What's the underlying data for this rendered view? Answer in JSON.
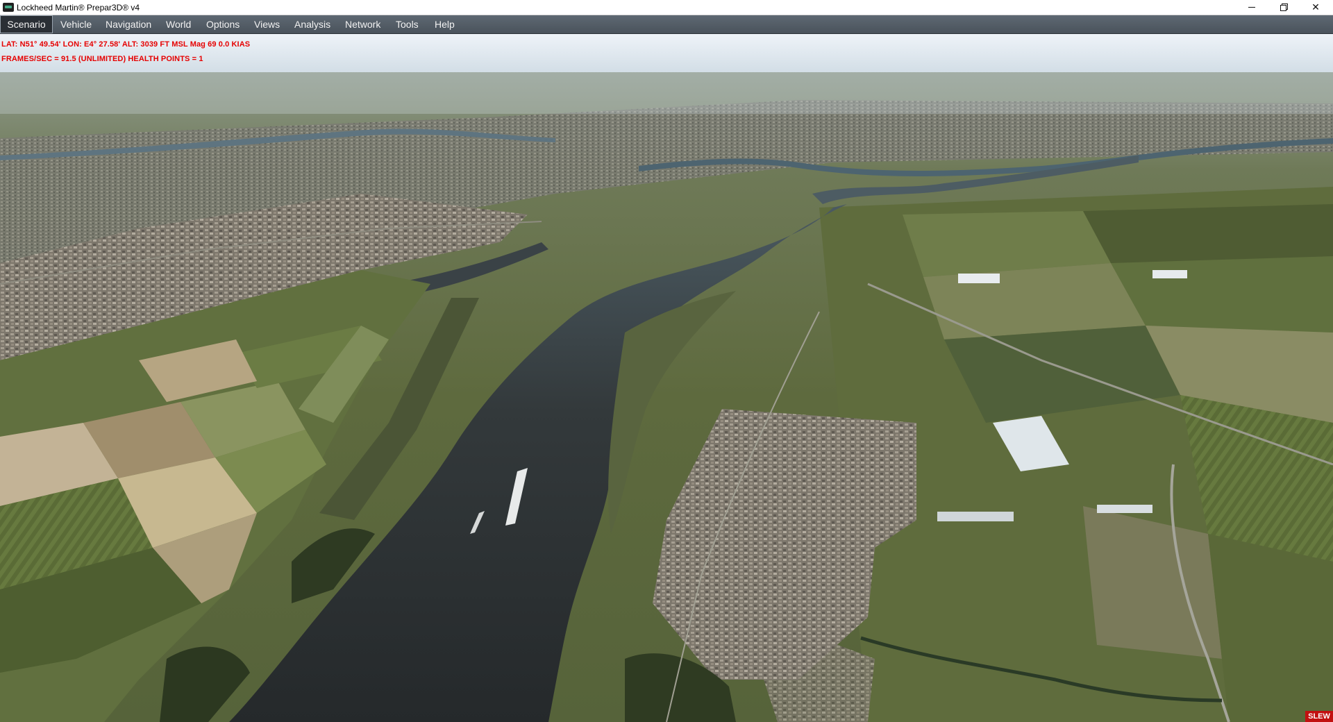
{
  "window": {
    "title": "Lockheed Martin® Prepar3D® v4",
    "min_icon": "minimize-icon",
    "max_icon": "restore-icon",
    "close_icon": "close-icon",
    "close_glyph": "✕"
  },
  "menu": {
    "items": [
      {
        "label": "Scenario",
        "active": true
      },
      {
        "label": "Vehicle"
      },
      {
        "label": "Navigation"
      },
      {
        "label": "World"
      },
      {
        "label": "Options"
      },
      {
        "label": "Views"
      },
      {
        "label": "Analysis"
      },
      {
        "label": "Network"
      },
      {
        "label": "Tools"
      },
      {
        "label": "Help"
      }
    ]
  },
  "hud": {
    "line1": "LAT: N51° 49.54'  LON: E4° 27.58'  ALT: 3039 FT  MSL   Mag 69  0.0 KIAS",
    "line2": "FRAMES/SEC = 91.5   (UNLIMITED)   HEALTH POINTS = 1",
    "color": "#e60000"
  },
  "status": {
    "slew": "SLEW"
  },
  "colors": {
    "sky": "#dfe9f1",
    "river": "#2a2f31",
    "field_green": "#5b6c3c",
    "field_tan": "#a89a78",
    "town": "#8a8378"
  }
}
